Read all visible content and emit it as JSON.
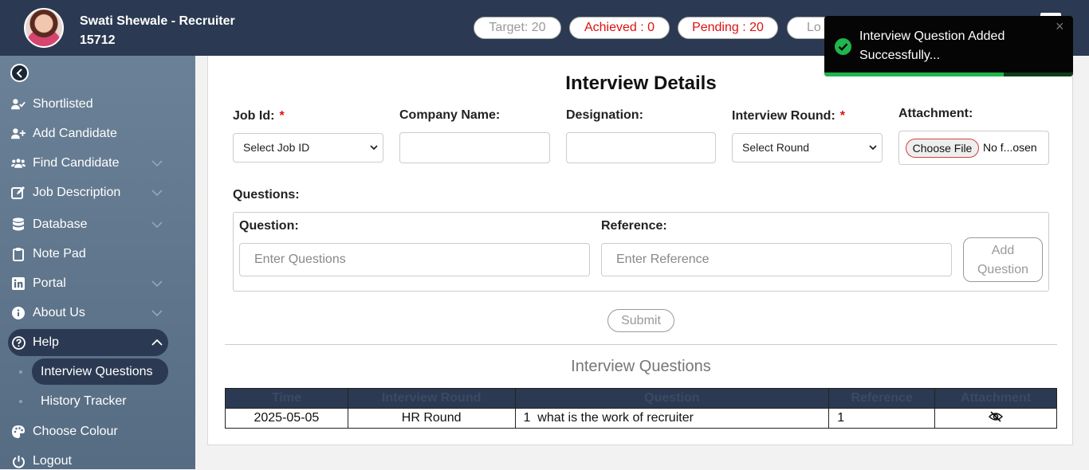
{
  "header": {
    "user_name": "Swati Shewale - Recruiter",
    "user_id": "15712",
    "target": "Target: 20",
    "achieved": "Achieved : 0",
    "pending": "Pending : 20",
    "logout_partial": "Lo"
  },
  "sidebar": {
    "items": [
      {
        "label": "Shortlisted"
      },
      {
        "label": "Add Candidate"
      },
      {
        "label": "Find Candidate"
      },
      {
        "label": "Job Description"
      },
      {
        "label": "Database"
      },
      {
        "label": "Note Pad"
      },
      {
        "label": "Portal"
      },
      {
        "label": "About Us"
      },
      {
        "label": "Help"
      },
      {
        "label": "Choose Colour"
      },
      {
        "label": "Logout"
      }
    ],
    "help_sub": [
      {
        "label": "Interview Questions"
      },
      {
        "label": "History Tracker"
      }
    ]
  },
  "form": {
    "title": "Interview Details",
    "job_id_label": "Job Id:",
    "job_id_value": "Select Job ID",
    "company_label": "Company Name:",
    "designation_label": "Designation:",
    "round_label": "Interview Round:",
    "round_value": "Select Round",
    "attachment_label": "Attachment:",
    "choose_file": "Choose File",
    "no_file": "No f...osen",
    "required_mark": "*",
    "questions_label": "Questions:",
    "question_label": "Question:",
    "question_placeholder": "Enter Questions",
    "reference_label": "Reference:",
    "reference_placeholder": "Enter Reference",
    "add_question_line1": "Add",
    "add_question_line2": "Question",
    "submit": "Submit"
  },
  "table": {
    "title": "Interview Questions",
    "headers": [
      "Time",
      "Interview Round",
      "Question",
      "Reference",
      "Attachment"
    ],
    "rows": [
      {
        "time": "2025-05-05",
        "round": "HR Round",
        "question": "1  what is the work of recruiter",
        "reference": "1"
      }
    ]
  },
  "toast": {
    "line1": "Interview Question Added",
    "line2": "Successfully...",
    "close": "×",
    "progress": 0.72
  },
  "colors": {
    "header_bg": "#2b3a52",
    "accent_red": "#d11",
    "success_green": "#1fb64b",
    "toast_bg": "#050505"
  }
}
